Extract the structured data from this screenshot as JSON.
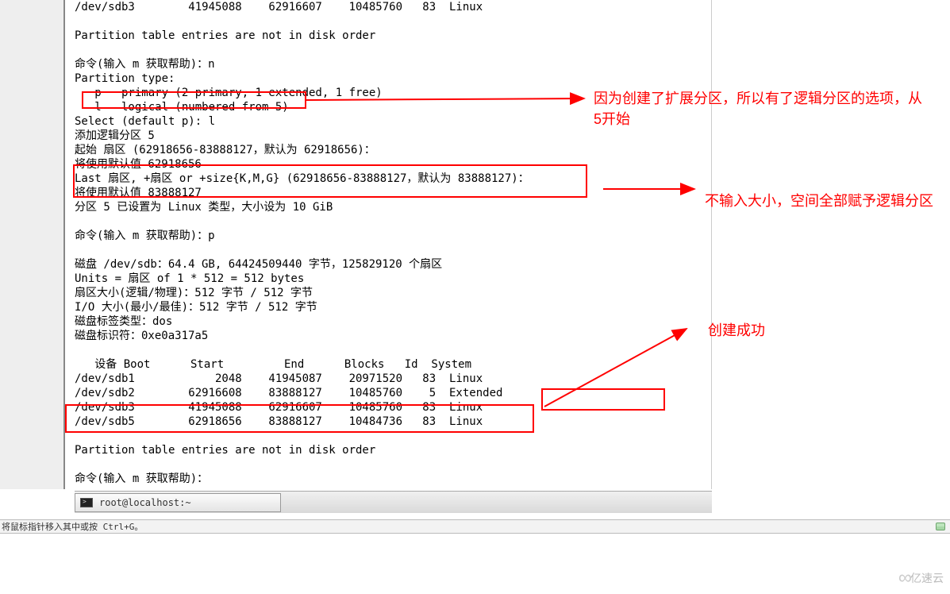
{
  "terminal": {
    "lines": [
      "/dev/sdb3        41945088    62916607    10485760   83  Linux",
      "",
      "Partition table entries are not in disk order",
      "",
      "命令(输入 m 获取帮助)：n",
      "Partition type:",
      "   p   primary (2 primary, 1 extended, 1 free)",
      "   l   logical (numbered from 5)",
      "Select (default p): l",
      "添加逻辑分区 5",
      "起始 扇区 (62918656-83888127，默认为 62918656)：",
      "将使用默认值 62918656",
      "Last 扇区, +扇区 or +size{K,M,G} (62918656-83888127，默认为 83888127)：",
      "将使用默认值 83888127",
      "分区 5 已设置为 Linux 类型，大小设为 10 GiB",
      "",
      "命令(输入 m 获取帮助)：p",
      "",
      "磁盘 /dev/sdb：64.4 GB, 64424509440 字节，125829120 个扇区",
      "Units = 扇区 of 1 * 512 = 512 bytes",
      "扇区大小(逻辑/物理)：512 字节 / 512 字节",
      "I/O 大小(最小/最佳)：512 字节 / 512 字节",
      "磁盘标签类型：dos",
      "磁盘标识符：0xe0a317a5",
      "",
      "   设备 Boot      Start         End      Blocks   Id  System",
      "/dev/sdb1            2048    41945087    20971520   83  Linux",
      "/dev/sdb2        62916608    83888127    10485760    5  Extended",
      "/dev/sdb3        41945088    62916607    10485760   83  Linux",
      "/dev/sdb5        62918656    83888127    10484736   83  Linux",
      "",
      "Partition table entries are not in disk order",
      "",
      "命令(输入 m 获取帮助)："
    ]
  },
  "chart_data": {
    "type": "table",
    "title": "磁盘 /dev/sdb 分区表",
    "disk": "/dev/sdb",
    "size_gb": 64.4,
    "size_bytes": 64424509440,
    "sectors": 125829120,
    "sector_size_bytes": 512,
    "label_type": "dos",
    "identifier": "0xe0a317a5",
    "columns": [
      "设备",
      "Boot",
      "Start",
      "End",
      "Blocks",
      "Id",
      "System"
    ],
    "rows": [
      {
        "device": "/dev/sdb1",
        "boot": "",
        "start": 2048,
        "end": 41945087,
        "blocks": 20971520,
        "id": "83",
        "system": "Linux"
      },
      {
        "device": "/dev/sdb2",
        "boot": "",
        "start": 62916608,
        "end": 83888127,
        "blocks": 10485760,
        "id": "5",
        "system": "Extended"
      },
      {
        "device": "/dev/sdb3",
        "boot": "",
        "start": 41945088,
        "end": 62916607,
        "blocks": 10485760,
        "id": "83",
        "system": "Linux"
      },
      {
        "device": "/dev/sdb5",
        "boot": "",
        "start": 62918656,
        "end": 83888127,
        "blocks": 10484736,
        "id": "83",
        "system": "Linux"
      }
    ]
  },
  "annotations": {
    "a1": "因为创建了扩展分区，所以有了逻辑分区的选项，从5开始",
    "a2": "不输入大小，空间全部赋予逻辑分区",
    "a3": "创建成功"
  },
  "taskbar": {
    "item1": "root@localhost:~"
  },
  "statusbar": {
    "text": "将鼠标指针移入其中或按 Ctrl+G。"
  },
  "watermark": {
    "text": "亿速云"
  }
}
